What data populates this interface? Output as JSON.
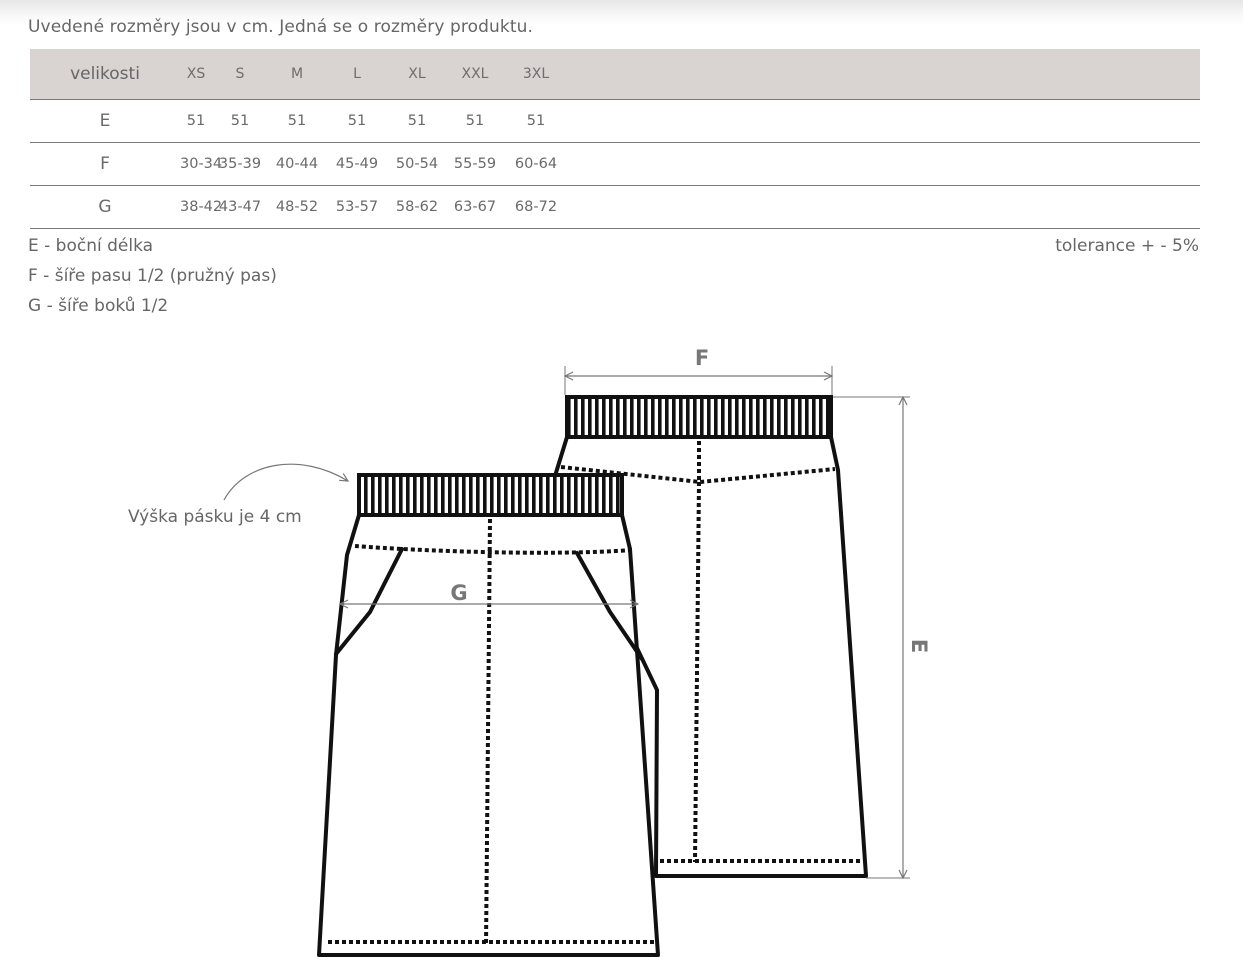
{
  "intro": "Uvedené rozměry jsou v cm. Jedná se o rozměry produktu.",
  "table": {
    "header_label": "velikosti",
    "sizes": [
      "XS",
      "S",
      "M",
      "L",
      "XL",
      "XXL",
      "3XL"
    ],
    "rows": [
      {
        "label": "E",
        "values": [
          "51",
          "51",
          "51",
          "51",
          "51",
          "51",
          "51"
        ]
      },
      {
        "label": "F",
        "values": [
          "30-34",
          "35-39",
          "40-44",
          "45-49",
          "50-54",
          "55-59",
          "60-64"
        ]
      },
      {
        "label": "G",
        "values": [
          "38-42",
          "43-47",
          "48-52",
          "53-57",
          "58-62",
          "63-67",
          "68-72"
        ]
      }
    ]
  },
  "legend": [
    "E - boční délka",
    "F - šíře pasu 1/2 (pružný pas)",
    "G - šíře boků 1/2"
  ],
  "tolerance": "tolerance + - 5%",
  "diagram": {
    "belt_note": "Výška pásku je 4 cm",
    "label_f": "F",
    "label_g": "G",
    "label_e": "E"
  }
}
